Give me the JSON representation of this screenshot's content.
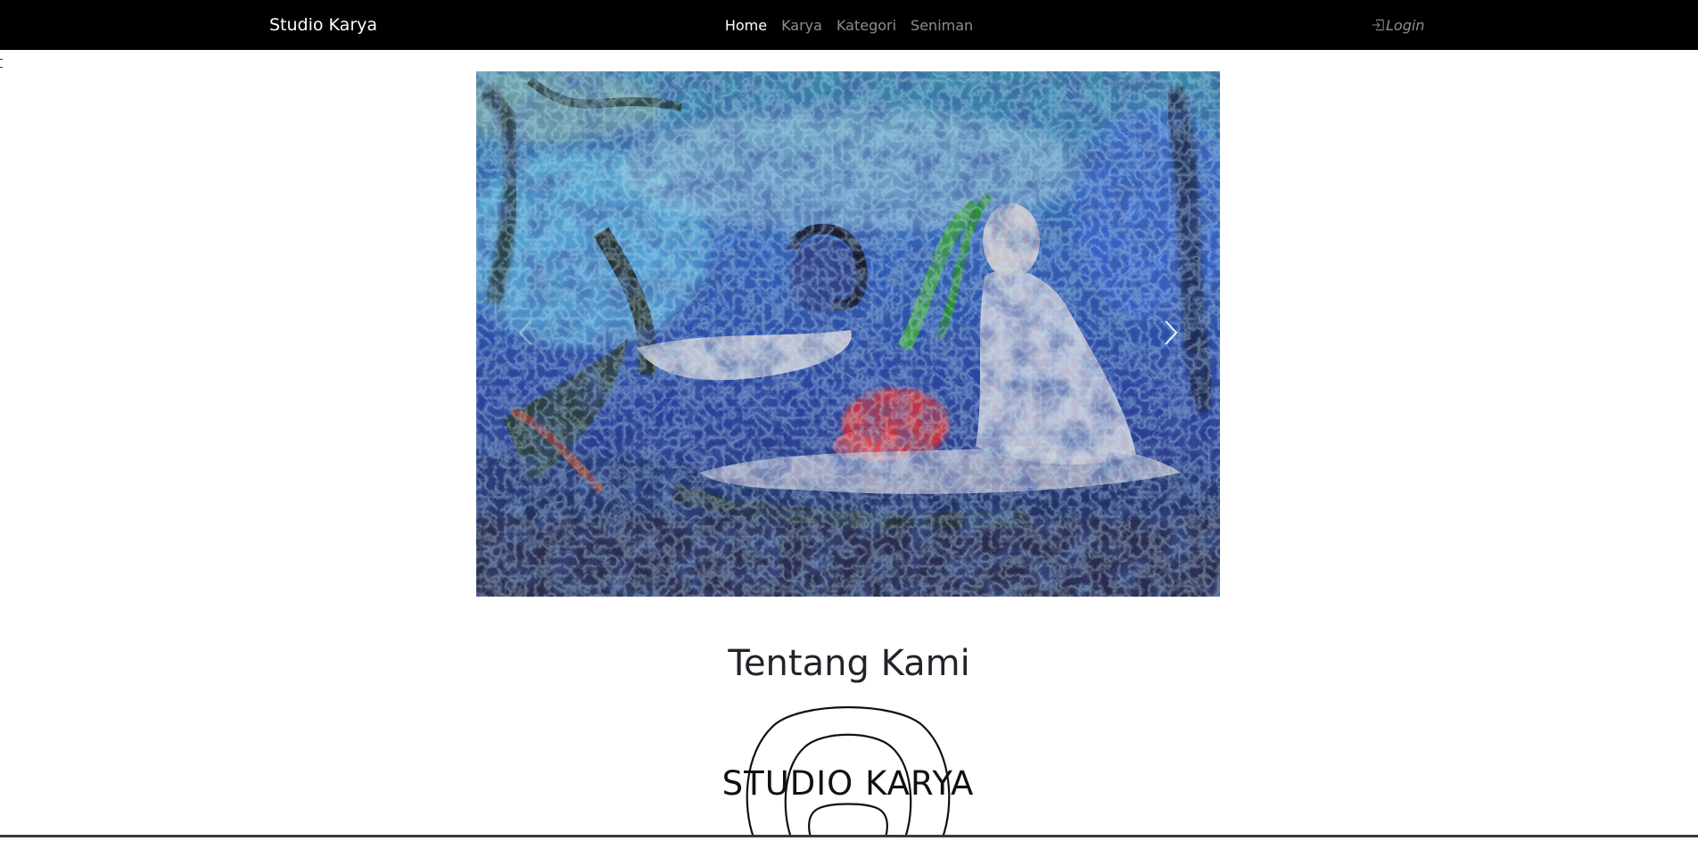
{
  "navbar": {
    "brand": "Studio Karya",
    "links": [
      {
        "label": "Home",
        "active": true
      },
      {
        "label": "Karya",
        "active": false
      },
      {
        "label": "Kategori",
        "active": false
      },
      {
        "label": "Seniman",
        "active": false
      }
    ],
    "login_label": "Login",
    "login_icon": "box-arrow-in-right-icon"
  },
  "carousel": {
    "prev_icon": "chevron-left-icon",
    "next_icon": "chevron-right-icon"
  },
  "about": {
    "title": "Tentang Kami",
    "logo_text": "STUDIO KARYA"
  },
  "colors": {
    "navbar_bg": "#000000",
    "nav_active": "#ffffff",
    "nav_inactive": "#8c8c8c",
    "heading": "#212529"
  }
}
